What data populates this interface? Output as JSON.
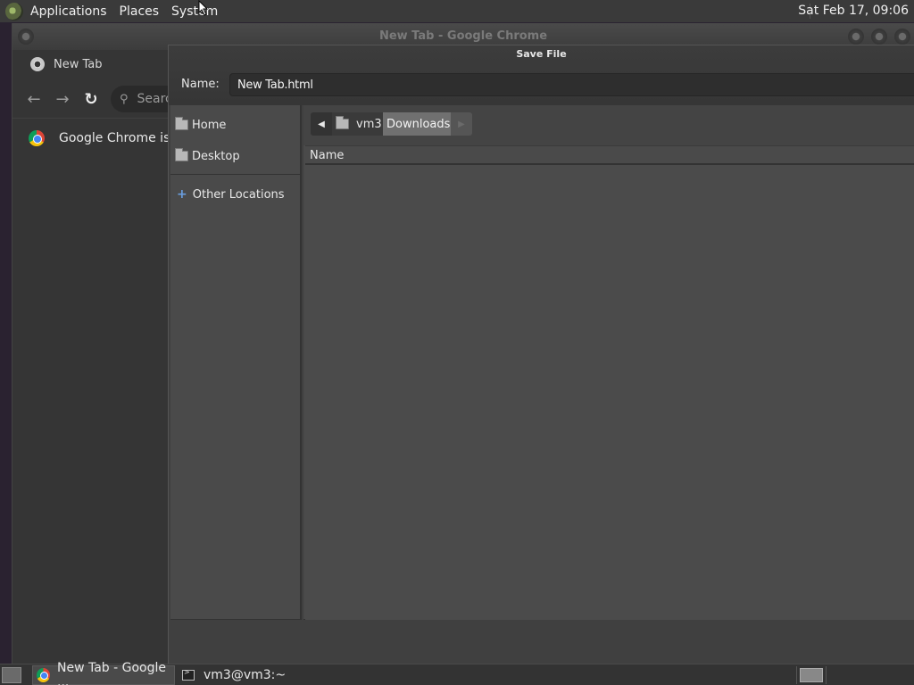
{
  "top_panel": {
    "menus": [
      "Applications",
      "Places",
      "System"
    ],
    "clock": "Sat Feb 17, 09:06"
  },
  "chrome": {
    "window_title": "New Tab - Google Chrome",
    "tab_label": "New Tab",
    "omnibox_text": "Searc",
    "infobar_text": "Google Chrome isn't"
  },
  "dialog": {
    "title": "Save File",
    "name_label": "Name:",
    "name_value": "New Tab.html",
    "places": [
      "Home",
      "Desktop",
      "Other Locations"
    ],
    "path": [
      "vm3",
      "Downloads"
    ],
    "column_name": "Name"
  },
  "taskbar": {
    "tasks": [
      "New Tab - Google ...",
      "vm3@vm3:~"
    ]
  }
}
